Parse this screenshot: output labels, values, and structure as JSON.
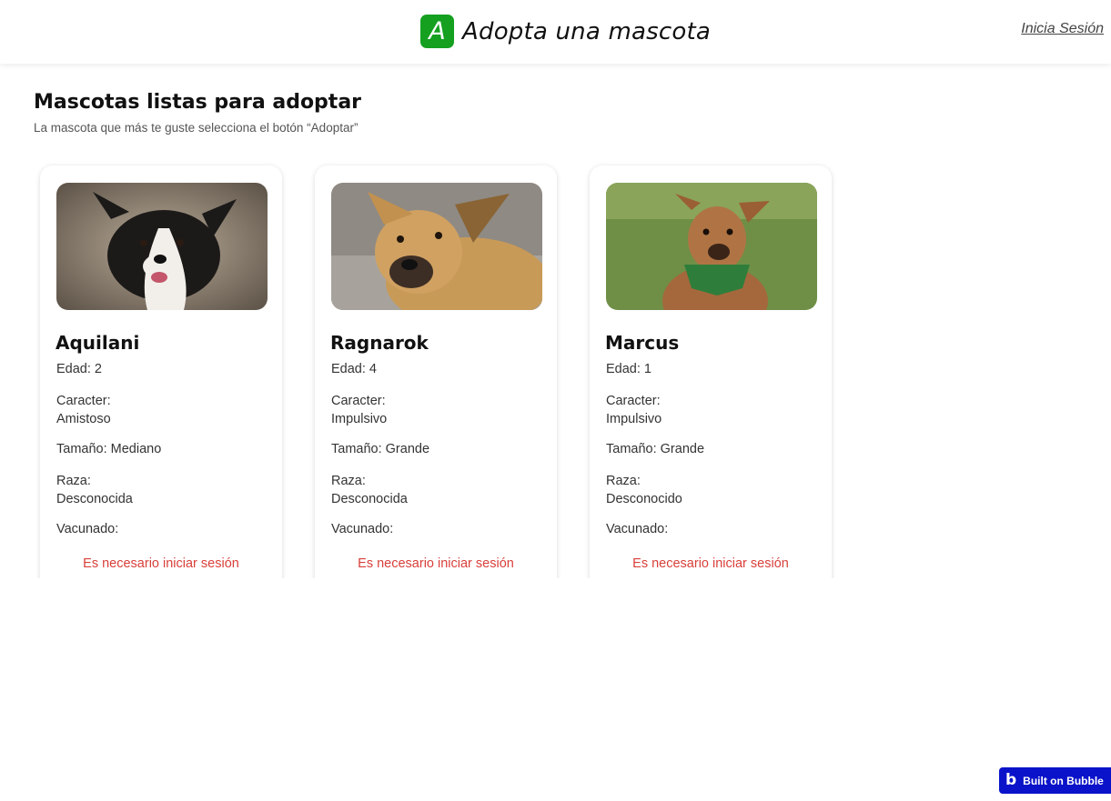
{
  "header": {
    "logo_letter": "A",
    "title": "Adopta una mascota",
    "login_label": "Inicia Sesión",
    "logo_color": "#15a020"
  },
  "main": {
    "title": "Mascotas listas para adoptar",
    "subtitle": "La mascota que más te guste selecciona el botón “Adoptar”"
  },
  "pets": [
    {
      "name": "Aquilani",
      "edad": "Edad: 2",
      "caracter_label": "Caracter:",
      "caracter": "Amistoso",
      "tamano": "Tamaño: Mediano",
      "raza_label": "Raza:",
      "raza": "Desconocida",
      "vacunado": "Vacunado:",
      "login_required": "Es necesario iniciar sesión",
      "photo": "border-collie-dog-photo"
    },
    {
      "name": "Ragnarok",
      "edad": "Edad: 4",
      "caracter_label": "Caracter:",
      "caracter": "Impulsivo",
      "tamano": "Tamaño: Grande",
      "raza_label": "Raza:",
      "raza": "Desconocida",
      "vacunado": "Vacunado:",
      "login_required": "Es necesario iniciar sesión",
      "photo": "tan-boxer-mix-dog-photo"
    },
    {
      "name": "Marcus",
      "edad": "Edad: 1",
      "caracter_label": "Caracter:",
      "caracter": "Impulsivo",
      "tamano": "Tamaño: Grande",
      "raza_label": "Raza:",
      "raza": "Desconocido",
      "vacunado": "Vacunado:",
      "login_required": "Es necesario iniciar sesión",
      "photo": "brown-dog-green-bandana-photo"
    }
  ],
  "badge": {
    "label": "Built on Bubble",
    "icon": "bubble-logo-icon",
    "color": "#0a13c9"
  },
  "colors": {
    "warning_text": "#d9403a"
  }
}
